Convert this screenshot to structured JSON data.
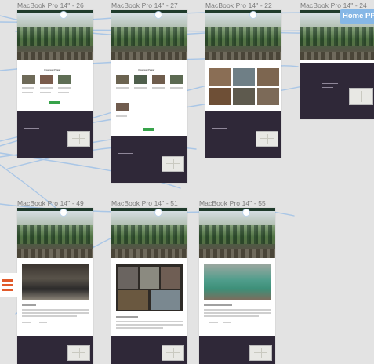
{
  "frames": [
    {
      "id": "f26",
      "label": "MacBook Pro 14\" - 26"
    },
    {
      "id": "f27",
      "label": "MacBook Pro 14\" - 27"
    },
    {
      "id": "f22",
      "label": "MacBook Pro 14\" - 22"
    },
    {
      "id": "f24",
      "label": "MacBook Pro 14\" - 24"
    },
    {
      "id": "f49",
      "label": "MacBook Pro 14\" - 49"
    },
    {
      "id": "f51",
      "label": "MacBook Pro 14\" - 51"
    },
    {
      "id": "f55",
      "label": "MacBook Pro 14\" - 55"
    }
  ],
  "prototype_badge": "Home PPD",
  "frame_headings": {
    "f26": "Organisasi Pelajar",
    "f27": "Organisasi Pelajar"
  },
  "colors": {
    "canvas": "#e3e3e3",
    "footer": "#2f2838",
    "connector": "#a9c6e6",
    "button_green": "#37a34a"
  }
}
